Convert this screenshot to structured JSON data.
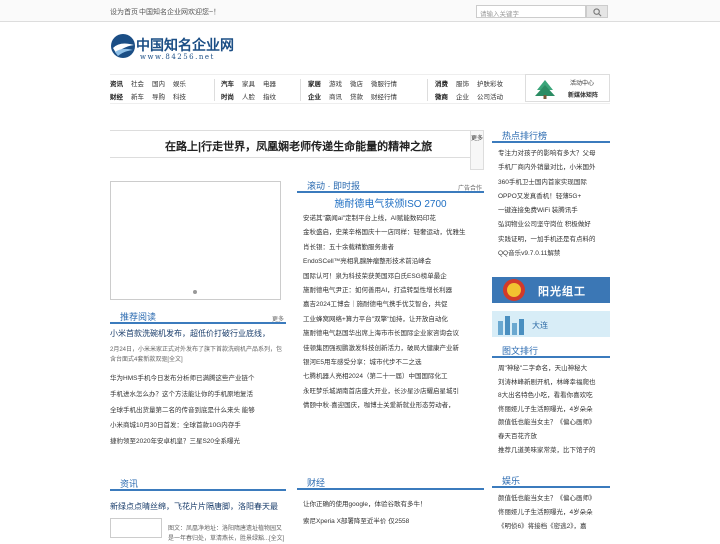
{
  "topbar": {
    "set_home": "设为首页",
    "welcome": "中国知名企业网欢迎您~！"
  },
  "search": {
    "placeholder": "请输入关键字"
  },
  "logo": {
    "title": "中国知名企业网",
    "url": "www.84256.net"
  },
  "nav": {
    "g1": [
      [
        "资讯",
        "社会",
        "国内",
        "娱乐"
      ],
      [
        "财经",
        "新车",
        "导购",
        "科技"
      ]
    ],
    "g2": [
      [
        "汽车",
        "家具",
        "电器"
      ],
      [
        "时尚",
        "人脸",
        "指纹"
      ]
    ],
    "g3": [
      [
        "家居",
        "游戏",
        "微店",
        "微服行情"
      ],
      [
        "企业",
        "商讯",
        "贷款",
        "财经行情"
      ]
    ],
    "g4": [
      [
        "消费",
        "服饰",
        "护肤彩妆"
      ],
      [
        "微商",
        "企业",
        "公司活动"
      ]
    ]
  },
  "ad": {
    "line1": "活动中心",
    "line2": "新媒体矩阵"
  },
  "headline": "在路上|行走世界，凤凰娴老师传递生命能量的精神之旅",
  "more_side": "更多",
  "hot": {
    "title": "热点排行榜",
    "items": [
      "专注力对孩子的影响有多大？父母",
      "手机厂商内外销量对比，小米国外",
      "360手机卫士国内首家实现国际",
      "OPPO又发真香机！轻薄5G+",
      "一键连接免费WiFi 装腾讯手",
      "弘润物业公司坚守岗位 积极做好",
      "实践证明，一加手机还是有点料的",
      "QQ音乐v9.7.0.11解禁"
    ]
  },
  "banner1": "阳光组工",
  "banner2": "大连",
  "pics": {
    "title": "图文排行",
    "items": [
      "周\"神秘\"二字命名，天山神秘大",
      "刘涛林峰新剧开机，林峰幸福爬也",
      "8大出名特色小吃，看看你喜欢吃",
      "佟丽娅儿子生活照曝光，4岁朵朵",
      "颜值低也能当女主？《偏心画师》",
      "春天百花齐放",
      "推荐几道美味家常菜，比下馆子的"
    ]
  },
  "ent": {
    "title": "娱乐",
    "items": [
      "颜值低也能当女主？《偏心画师》",
      "佟丽娅儿子生活照曝光，4岁朵朵",
      "《明侦6》将接档《密逃2》，嘉"
    ]
  },
  "rec": {
    "title": "推荐阅读",
    "more": "更多",
    "lead": "小米首款洗碗机发布，超低价打破行业底线，",
    "desc": "2月24日，小米米家正式对外发布了旗下首款洗碗机产品系列，包含台面式4套新款双驱[全文]",
    "items": [
      "华为HMS手机今日发布分析师已满腾这些产业链个",
      "手机进水怎么办？这个方法能让你的手机原地复活",
      "全球手机出货量第二名的传音到底是什么来头 能够",
      "小米商城10月30日首发：全球首款10G内存手",
      "捷豹领至2020年安卓机皇？三星S20全系曝光"
    ]
  },
  "news": {
    "title": "资讯",
    "lead": "新绿点点晴丝绵，飞花片片隔唐脚，洛阳春天最",
    "desc": "图文：凤凰净地址：洛阳隋唐遗址植物园又是一年春归处，草清燕长，胜景绿豁...[全文]"
  },
  "roll": {
    "title": "滚动 · 即时报",
    "ad": "广告合作",
    "headline": "施耐德电气获颁ISO 2700",
    "items": [
      "安诺其\"赢闻ai\"定制平台上线，AI赋能数码印花",
      "金秋盛启，史莱辛格国庆十一店同样：轻奢运动，优雅生",
      "肖长银：五十余载精勤服务患者",
      "EndoSCell™亮相乳腺肿瘤整形技术前沿峰会",
      "国际认可！泉为科技荣获美国邓白氏ESG榜单最企",
      "施耐德电气尹正：如何善用AI，打造转型性增长利器",
      "嘉吉2024工博会｜施耐德电气携手优艾智合，共促",
      "工业蜂窝网络+算力平台\"双擎\"加持，让开放自动化",
      "施耐德电气赵国华出席上海市市长国际企业家咨询会议",
      "佳顿集团强视鹏激发科技创新活力，破局大健康产业新",
      "银河E5用车感受分享：城市代步不二之选",
      "七腾机器人亮相2024（第二十一届）中国国际化工",
      "永旺梦乐城湖南首店盛大开业，长沙星沙店耀启星城引",
      "倩颐中秋·喜迎国庆，咖博士关爱新就业形态劳动者，"
    ]
  },
  "fin": {
    "title": "财经",
    "items": [
      "让你正确的使用google，体验谷歌有多牛！",
      "索尼Xperia X部署降至近半价 仅2558"
    ]
  }
}
